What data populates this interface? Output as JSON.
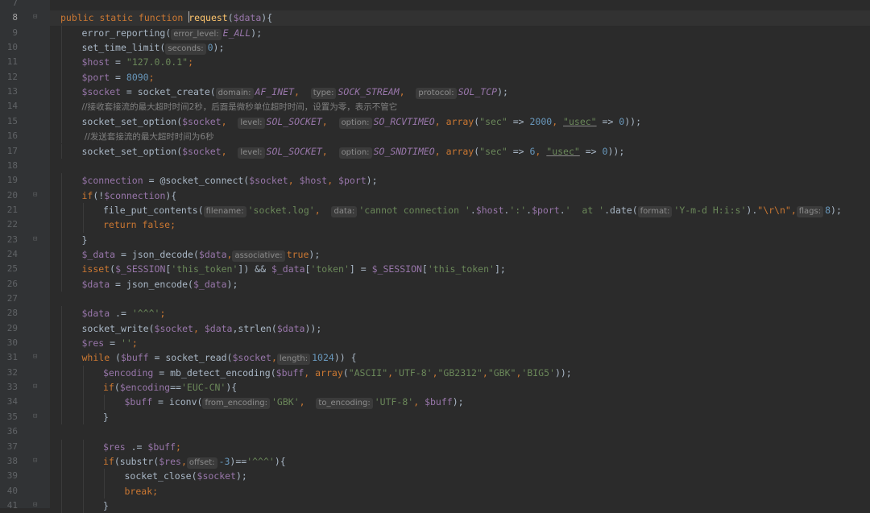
{
  "active_line": "8",
  "lines": [
    {
      "n": "7",
      "indent": 0,
      "fold": "",
      "tokens": []
    },
    {
      "n": "8",
      "indent": 0,
      "fold": "⊟",
      "current": true,
      "tokens": [
        {
          "t": "public static function ",
          "c": "kw"
        },
        {
          "t": "",
          "c": "caret"
        },
        {
          "t": "request",
          "c": "fn"
        },
        {
          "t": "(",
          "c": "plain"
        },
        {
          "t": "$data",
          "c": "var"
        },
        {
          "t": "){",
          "c": "plain"
        }
      ]
    },
    {
      "n": "9",
      "indent": 1,
      "fold": "",
      "tokens": [
        {
          "t": "error_reporting(",
          "c": "plain"
        },
        {
          "t": "error_level:",
          "c": "hint"
        },
        {
          "t": "E_ALL",
          "c": "const"
        },
        {
          "t": ");",
          "c": "plain"
        }
      ]
    },
    {
      "n": "10",
      "indent": 1,
      "fold": "",
      "tokens": [
        {
          "t": "set_time_limit(",
          "c": "plain"
        },
        {
          "t": "seconds:",
          "c": "hint"
        },
        {
          "t": "0",
          "c": "num"
        },
        {
          "t": ");",
          "c": "plain"
        }
      ]
    },
    {
      "n": "11",
      "indent": 1,
      "fold": "",
      "tokens": [
        {
          "t": "$host",
          "c": "var"
        },
        {
          "t": " = ",
          "c": "plain"
        },
        {
          "t": "\"127.0.0.1\"",
          "c": "str"
        },
        {
          "t": ";",
          "c": "kw"
        }
      ]
    },
    {
      "n": "12",
      "indent": 1,
      "fold": "",
      "tokens": [
        {
          "t": "$port",
          "c": "var"
        },
        {
          "t": " = ",
          "c": "plain"
        },
        {
          "t": "8090",
          "c": "num"
        },
        {
          "t": ";",
          "c": "kw"
        }
      ]
    },
    {
      "n": "13",
      "indent": 1,
      "fold": "",
      "tokens": [
        {
          "t": "$socket",
          "c": "var"
        },
        {
          "t": " = socket_create(",
          "c": "plain"
        },
        {
          "t": "domain:",
          "c": "hint"
        },
        {
          "t": "AF_INET",
          "c": "const"
        },
        {
          "t": ",  ",
          "c": "kw"
        },
        {
          "t": "type:",
          "c": "hint"
        },
        {
          "t": "SOCK_STREAM",
          "c": "const"
        },
        {
          "t": ",  ",
          "c": "kw"
        },
        {
          "t": "protocol:",
          "c": "hint"
        },
        {
          "t": "SOL_TCP",
          "c": "const"
        },
        {
          "t": ");",
          "c": "plain"
        }
      ]
    },
    {
      "n": "14",
      "indent": 1,
      "fold": "",
      "tokens": [
        {
          "t": "//接收套接流的最大超时时间2秒，后面是微秒单位超时时间，设置为零，表示不管它",
          "c": "cmt"
        }
      ]
    },
    {
      "n": "15",
      "indent": 1,
      "fold": "",
      "tokens": [
        {
          "t": "socket_set_option(",
          "c": "plain"
        },
        {
          "t": "$socket",
          "c": "var"
        },
        {
          "t": ",  ",
          "c": "kw"
        },
        {
          "t": "level:",
          "c": "hint"
        },
        {
          "t": "SOL_SOCKET",
          "c": "const"
        },
        {
          "t": ",  ",
          "c": "kw"
        },
        {
          "t": "option:",
          "c": "hint"
        },
        {
          "t": "SO_RCVTIMEO",
          "c": "const"
        },
        {
          "t": ", ",
          "c": "kw"
        },
        {
          "t": "array",
          "c": "kw"
        },
        {
          "t": "(",
          "c": "plain"
        },
        {
          "t": "\"sec\"",
          "c": "str"
        },
        {
          "t": " => ",
          "c": "plain"
        },
        {
          "t": "2000",
          "c": "num"
        },
        {
          "t": ", ",
          "c": "kw"
        },
        {
          "t": "\"usec\"",
          "c": "str ul"
        },
        {
          "t": " => ",
          "c": "plain"
        },
        {
          "t": "0",
          "c": "num"
        },
        {
          "t": "));",
          "c": "plain"
        }
      ]
    },
    {
      "n": "16",
      "indent": 1,
      "fold": "",
      "tokens": [
        {
          "t": " //发送套接流的最大超时时间为6秒",
          "c": "cmt"
        }
      ]
    },
    {
      "n": "17",
      "indent": 1,
      "fold": "",
      "tokens": [
        {
          "t": "socket_set_option(",
          "c": "plain"
        },
        {
          "t": "$socket",
          "c": "var"
        },
        {
          "t": ",  ",
          "c": "kw"
        },
        {
          "t": "level:",
          "c": "hint"
        },
        {
          "t": "SOL_SOCKET",
          "c": "const"
        },
        {
          "t": ",  ",
          "c": "kw"
        },
        {
          "t": "option:",
          "c": "hint"
        },
        {
          "t": "SO_SNDTIMEO",
          "c": "const"
        },
        {
          "t": ", ",
          "c": "kw"
        },
        {
          "t": "array",
          "c": "kw"
        },
        {
          "t": "(",
          "c": "plain"
        },
        {
          "t": "\"sec\"",
          "c": "str"
        },
        {
          "t": " => ",
          "c": "plain"
        },
        {
          "t": "6",
          "c": "num"
        },
        {
          "t": ", ",
          "c": "kw"
        },
        {
          "t": "\"usec\"",
          "c": "str ul"
        },
        {
          "t": " => ",
          "c": "plain"
        },
        {
          "t": "0",
          "c": "num"
        },
        {
          "t": "));",
          "c": "plain"
        }
      ]
    },
    {
      "n": "18",
      "indent": 0,
      "fold": "",
      "tokens": []
    },
    {
      "n": "19",
      "indent": 1,
      "fold": "",
      "tokens": [
        {
          "t": "$connection",
          "c": "var"
        },
        {
          "t": " = @socket_connect(",
          "c": "plain"
        },
        {
          "t": "$socket",
          "c": "var"
        },
        {
          "t": ", ",
          "c": "kw"
        },
        {
          "t": "$host",
          "c": "var"
        },
        {
          "t": ", ",
          "c": "kw"
        },
        {
          "t": "$port",
          "c": "var"
        },
        {
          "t": ");",
          "c": "plain"
        }
      ]
    },
    {
      "n": "20",
      "indent": 1,
      "fold": "⊟",
      "tokens": [
        {
          "t": "if",
          "c": "kw"
        },
        {
          "t": "(!",
          "c": "plain"
        },
        {
          "t": "$connection",
          "c": "var"
        },
        {
          "t": "){",
          "c": "plain"
        }
      ]
    },
    {
      "n": "21",
      "indent": 2,
      "fold": "",
      "tokens": [
        {
          "t": "file_put_contents(",
          "c": "plain"
        },
        {
          "t": "filename:",
          "c": "hint"
        },
        {
          "t": "'socket.log'",
          "c": "str"
        },
        {
          "t": ",  ",
          "c": "kw"
        },
        {
          "t": "data:",
          "c": "hint"
        },
        {
          "t": "'cannot connection '",
          "c": "str"
        },
        {
          "t": ".",
          "c": "plain"
        },
        {
          "t": "$host",
          "c": "var"
        },
        {
          "t": ".",
          "c": "plain"
        },
        {
          "t": "':'",
          "c": "str"
        },
        {
          "t": ".",
          "c": "plain"
        },
        {
          "t": "$port",
          "c": "var"
        },
        {
          "t": ".",
          "c": "plain"
        },
        {
          "t": "'  at '",
          "c": "str"
        },
        {
          "t": ".date(",
          "c": "plain"
        },
        {
          "t": "format:",
          "c": "hint"
        },
        {
          "t": "'Y-m-d H:i:s'",
          "c": "str"
        },
        {
          "t": ").",
          "c": "plain"
        },
        {
          "t": "\"\\r\\n\"",
          "c": "kw"
        },
        {
          "t": ",",
          "c": "kw"
        },
        {
          "t": "flags:",
          "c": "hint"
        },
        {
          "t": "8",
          "c": "num"
        },
        {
          "t": ");",
          "c": "plain"
        }
      ]
    },
    {
      "n": "22",
      "indent": 2,
      "fold": "",
      "tokens": [
        {
          "t": "return false",
          "c": "kw"
        },
        {
          "t": ";",
          "c": "kw"
        }
      ]
    },
    {
      "n": "23",
      "indent": 1,
      "fold": "⊟",
      "tokens": [
        {
          "t": "}",
          "c": "plain"
        }
      ]
    },
    {
      "n": "24",
      "indent": 1,
      "fold": "",
      "tokens": [
        {
          "t": "$_data",
          "c": "var"
        },
        {
          "t": " = json_decode(",
          "c": "plain"
        },
        {
          "t": "$data",
          "c": "var"
        },
        {
          "t": ",",
          "c": "kw"
        },
        {
          "t": "associative:",
          "c": "hint"
        },
        {
          "t": "true",
          "c": "kw"
        },
        {
          "t": ");",
          "c": "plain"
        }
      ]
    },
    {
      "n": "25",
      "indent": 1,
      "fold": "",
      "tokens": [
        {
          "t": "isset",
          "c": "kw"
        },
        {
          "t": "(",
          "c": "plain"
        },
        {
          "t": "$_SESSION",
          "c": "var"
        },
        {
          "t": "[",
          "c": "plain"
        },
        {
          "t": "'this_token'",
          "c": "str"
        },
        {
          "t": "]) && ",
          "c": "plain"
        },
        {
          "t": "$_data",
          "c": "var"
        },
        {
          "t": "[",
          "c": "plain"
        },
        {
          "t": "'token'",
          "c": "str"
        },
        {
          "t": "] = ",
          "c": "plain"
        },
        {
          "t": "$_SESSION",
          "c": "var"
        },
        {
          "t": "[",
          "c": "plain"
        },
        {
          "t": "'this_token'",
          "c": "str"
        },
        {
          "t": "];",
          "c": "plain"
        }
      ]
    },
    {
      "n": "26",
      "indent": 1,
      "fold": "",
      "tokens": [
        {
          "t": "$data",
          "c": "var"
        },
        {
          "t": " = json_encode(",
          "c": "plain"
        },
        {
          "t": "$_data",
          "c": "var"
        },
        {
          "t": ");",
          "c": "plain"
        }
      ]
    },
    {
      "n": "27",
      "indent": 0,
      "fold": "",
      "tokens": []
    },
    {
      "n": "28",
      "indent": 1,
      "fold": "",
      "tokens": [
        {
          "t": "$data",
          "c": "var"
        },
        {
          "t": " .= ",
          "c": "plain"
        },
        {
          "t": "'^^^'",
          "c": "str"
        },
        {
          "t": ";",
          "c": "kw"
        }
      ]
    },
    {
      "n": "29",
      "indent": 1,
      "fold": "",
      "tokens": [
        {
          "t": "socket_write(",
          "c": "plain"
        },
        {
          "t": "$socket",
          "c": "var"
        },
        {
          "t": ", ",
          "c": "kw"
        },
        {
          "t": "$data",
          "c": "var"
        },
        {
          "t": ",strlen(",
          "c": "plain"
        },
        {
          "t": "$data",
          "c": "var"
        },
        {
          "t": "));",
          "c": "plain"
        }
      ]
    },
    {
      "n": "30",
      "indent": 1,
      "fold": "",
      "tokens": [
        {
          "t": "$res",
          "c": "var"
        },
        {
          "t": " = ",
          "c": "plain"
        },
        {
          "t": "''",
          "c": "str"
        },
        {
          "t": ";",
          "c": "kw"
        }
      ]
    },
    {
      "n": "31",
      "indent": 1,
      "fold": "⊟",
      "tokens": [
        {
          "t": "while",
          "c": "kw"
        },
        {
          "t": " (",
          "c": "plain"
        },
        {
          "t": "$buff",
          "c": "var"
        },
        {
          "t": " = socket_read(",
          "c": "plain"
        },
        {
          "t": "$socket",
          "c": "var"
        },
        {
          "t": ",",
          "c": "kw"
        },
        {
          "t": "length:",
          "c": "hint"
        },
        {
          "t": "1024",
          "c": "num"
        },
        {
          "t": ")) {",
          "c": "plain"
        }
      ]
    },
    {
      "n": "32",
      "indent": 2,
      "fold": "",
      "tokens": [
        {
          "t": "$encoding",
          "c": "var"
        },
        {
          "t": " = mb_detect_encoding(",
          "c": "plain"
        },
        {
          "t": "$buff",
          "c": "var"
        },
        {
          "t": ", ",
          "c": "kw"
        },
        {
          "t": "array",
          "c": "kw"
        },
        {
          "t": "(",
          "c": "plain"
        },
        {
          "t": "\"ASCII\"",
          "c": "str"
        },
        {
          "t": ",",
          "c": "kw"
        },
        {
          "t": "'UTF-8'",
          "c": "str"
        },
        {
          "t": ",",
          "c": "kw"
        },
        {
          "t": "\"GB2312\"",
          "c": "str"
        },
        {
          "t": ",",
          "c": "kw"
        },
        {
          "t": "\"GBK\"",
          "c": "str"
        },
        {
          "t": ",",
          "c": "kw"
        },
        {
          "t": "'BIG5'",
          "c": "str"
        },
        {
          "t": "));",
          "c": "plain"
        }
      ]
    },
    {
      "n": "33",
      "indent": 2,
      "fold": "⊟",
      "tokens": [
        {
          "t": "if",
          "c": "kw"
        },
        {
          "t": "(",
          "c": "plain"
        },
        {
          "t": "$encoding",
          "c": "var"
        },
        {
          "t": "==",
          "c": "plain"
        },
        {
          "t": "'EUC-CN'",
          "c": "str"
        },
        {
          "t": "){",
          "c": "plain"
        }
      ]
    },
    {
      "n": "34",
      "indent": 3,
      "fold": "",
      "tokens": [
        {
          "t": "$buff",
          "c": "var"
        },
        {
          "t": " = iconv(",
          "c": "plain"
        },
        {
          "t": "from_encoding:",
          "c": "hint"
        },
        {
          "t": "'GBK'",
          "c": "str"
        },
        {
          "t": ",  ",
          "c": "kw"
        },
        {
          "t": "to_encoding:",
          "c": "hint"
        },
        {
          "t": "'UTF-8'",
          "c": "str"
        },
        {
          "t": ", ",
          "c": "kw"
        },
        {
          "t": "$buff",
          "c": "var"
        },
        {
          "t": ");",
          "c": "plain"
        }
      ]
    },
    {
      "n": "35",
      "indent": 2,
      "fold": "⊟",
      "tokens": [
        {
          "t": "}",
          "c": "plain"
        }
      ]
    },
    {
      "n": "36",
      "indent": 0,
      "fold": "",
      "tokens": []
    },
    {
      "n": "37",
      "indent": 2,
      "fold": "",
      "tokens": [
        {
          "t": "$res",
          "c": "var"
        },
        {
          "t": " .= ",
          "c": "plain"
        },
        {
          "t": "$buff",
          "c": "var"
        },
        {
          "t": ";",
          "c": "kw"
        }
      ]
    },
    {
      "n": "38",
      "indent": 2,
      "fold": "⊟",
      "tokens": [
        {
          "t": "if",
          "c": "kw"
        },
        {
          "t": "(substr(",
          "c": "plain"
        },
        {
          "t": "$res",
          "c": "var"
        },
        {
          "t": ",",
          "c": "kw"
        },
        {
          "t": "offset:",
          "c": "hint"
        },
        {
          "t": "-3",
          "c": "num"
        },
        {
          "t": ")==",
          "c": "plain"
        },
        {
          "t": "'^^^'",
          "c": "str"
        },
        {
          "t": "){",
          "c": "plain"
        }
      ]
    },
    {
      "n": "39",
      "indent": 3,
      "fold": "",
      "tokens": [
        {
          "t": "socket_close(",
          "c": "plain"
        },
        {
          "t": "$socket",
          "c": "var"
        },
        {
          "t": ");",
          "c": "plain"
        }
      ]
    },
    {
      "n": "40",
      "indent": 3,
      "fold": "",
      "tokens": [
        {
          "t": "break",
          "c": "kw"
        },
        {
          "t": ";",
          "c": "kw"
        }
      ]
    },
    {
      "n": "41",
      "indent": 2,
      "fold": "⊟",
      "tokens": [
        {
          "t": "}",
          "c": "plain"
        }
      ]
    }
  ]
}
